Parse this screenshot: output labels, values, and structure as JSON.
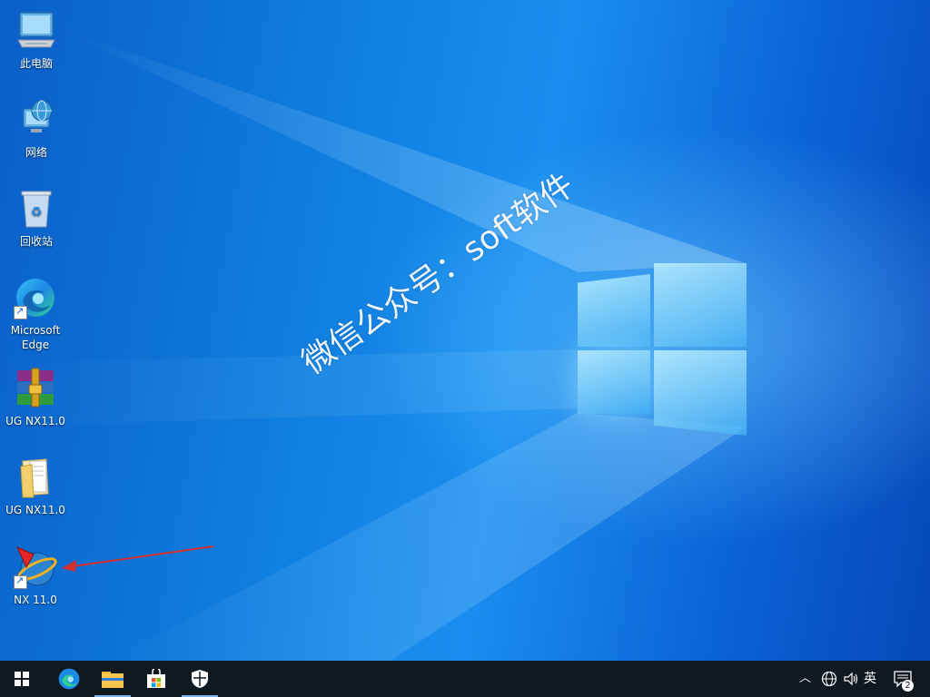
{
  "desktop": {
    "watermark": "微信公众号：soft软件",
    "icons": [
      {
        "name": "this-pc",
        "label": "此电脑",
        "icon": "computer-icon"
      },
      {
        "name": "network",
        "label": "网络",
        "icon": "network-globe-icon"
      },
      {
        "name": "recycle-bin",
        "label": "回收站",
        "icon": "recycle-bin-icon"
      },
      {
        "name": "microsoft-edge",
        "label": "Microsoft Edge",
        "icon": "edge-icon"
      },
      {
        "name": "ug-nx-archive",
        "label": "UG NX11.0",
        "icon": "winrar-archive-icon"
      },
      {
        "name": "ug-nx-folder",
        "label": "UG NX11.0",
        "icon": "folder-icon"
      },
      {
        "name": "nx-11",
        "label": "NX 11.0",
        "icon": "nx-app-icon"
      }
    ]
  },
  "taskbar": {
    "buttons": [
      {
        "name": "start",
        "icon": "windows-start-icon"
      },
      {
        "name": "edge",
        "icon": "edge-icon"
      },
      {
        "name": "file-explorer",
        "icon": "folder-icon"
      },
      {
        "name": "store",
        "icon": "store-bag-icon"
      },
      {
        "name": "security",
        "icon": "shield-icon"
      }
    ],
    "tray": {
      "ime_label": "英",
      "notification_count": "2"
    }
  },
  "colors": {
    "arrow": "#d32f2f",
    "taskbar": "#101820"
  }
}
